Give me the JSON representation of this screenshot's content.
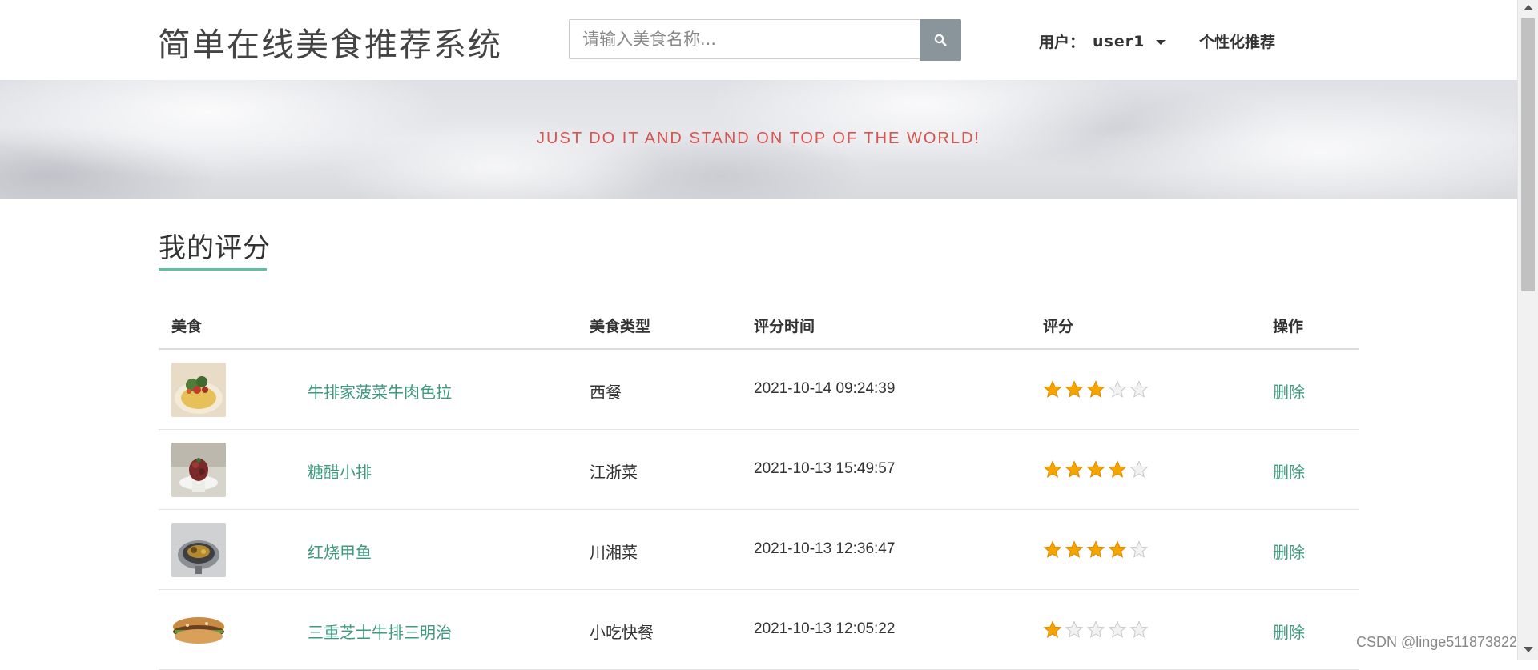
{
  "header": {
    "site_title": "简单在线美食推荐系统",
    "search_placeholder": "请输入美食名称...",
    "search_icon": "search-icon",
    "user_label": "用户：",
    "user_name": "user1",
    "recommend_label": "个性化推荐"
  },
  "banner": {
    "slogan": "JUST DO IT AND STAND ON TOP OF THE WORLD!"
  },
  "section": {
    "title": "我的评分",
    "accent_color": "#5fc0a4"
  },
  "table": {
    "headers": [
      "美食",
      "美食类型",
      "评分时间",
      "评分",
      "操作"
    ],
    "rows": [
      {
        "name": "牛排家菠菜牛肉色拉",
        "type": "西餐",
        "time": "2021-10-14 09:24:39",
        "rating": 3,
        "action": "删除"
      },
      {
        "name": "糖醋小排",
        "type": "江浙菜",
        "time": "2021-10-13 15:49:57",
        "rating": 4,
        "action": "删除"
      },
      {
        "name": "红烧甲鱼",
        "type": "川湘菜",
        "time": "2021-10-13 12:36:47",
        "rating": 4,
        "action": "删除"
      },
      {
        "name": "三重芝士牛排三明治",
        "type": "小吃快餐",
        "time": "2021-10-13 12:05:22",
        "rating": 1,
        "action": "删除"
      }
    ]
  },
  "colors": {
    "link": "#3e9a7f",
    "slogan": "#d9534f",
    "star_on": "#f5a400",
    "star_off": "#d8d8d8",
    "search_button": "#8a949b"
  },
  "watermark": "CSDN @linge511873822"
}
